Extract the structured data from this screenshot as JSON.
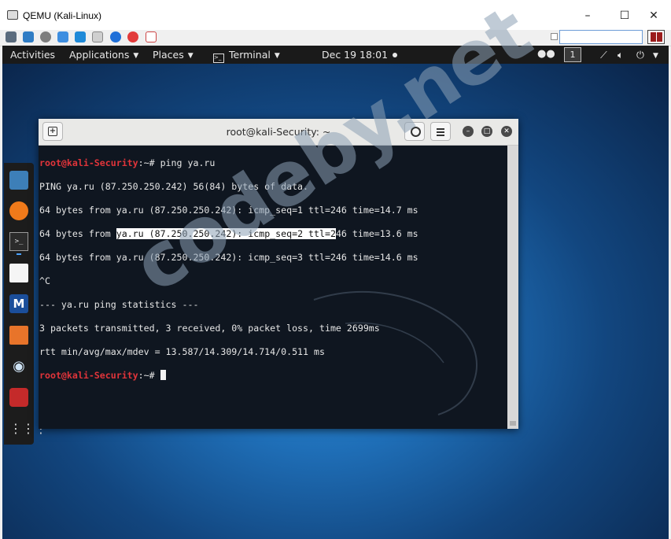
{
  "qemu": {
    "title": "QEMU (Kali-Linux)",
    "minimize": "–",
    "maximize": "☐",
    "close": "✕"
  },
  "gnome": {
    "activities": "Activities",
    "applications": "Applications",
    "places": "Places",
    "terminal": "Terminal",
    "clock": "Dec 19  18:01",
    "workspace": "1"
  },
  "terminal": {
    "title": "root@kali-Security: ~",
    "prompt_user": "root@kali-Security",
    "prompt_suffix": ":~#",
    "command": "ping ya.ru",
    "output": {
      "ping_header": "PING ya.ru (87.250.250.242) 56(84) bytes of data.",
      "reply1": "64 bytes from ya.ru (87.250.250.242): icmp_seq=1 ttl=246 time=14.7 ms",
      "reply2_pre": "64 bytes from ",
      "reply2_hl": "ya.ru (87.250.250.242): icmp_seq=2 ttl=2",
      "reply2_post": "46 time=13.6 ms",
      "reply3": "64 bytes from ya.ru (87.250.250.242): icmp_seq=3 ttl=246 time=14.6 ms",
      "interrupt": "^C",
      "stats_header": "--- ya.ru ping statistics ---",
      "stats_line": "3 packets transmitted, 3 received, 0% packet loss, time 2699ms",
      "rtt_line": "rtt min/avg/max/mdev = 13.587/14.309/14.714/0.511 ms"
    }
  },
  "watermark": "codeby.net",
  "colors": {
    "prompt_red": "#e0343a",
    "terminal_bg": "#0f1620",
    "gnome_bar": "#1a1a1a"
  },
  "icons": {
    "dock": [
      "files-icon",
      "firefox-icon",
      "terminal-icon",
      "text-editor-icon",
      "metasploit-icon",
      "burpsuite-icon",
      "eye-icon",
      "cherry-icon",
      "app-grid-icon"
    ]
  }
}
